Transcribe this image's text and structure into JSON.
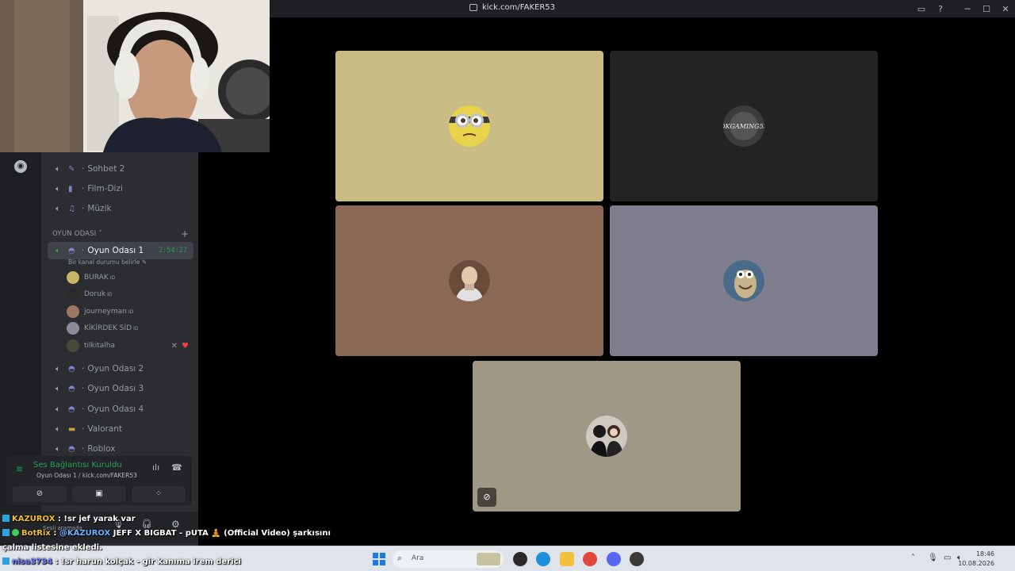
{
  "window": {
    "url_title": "kick.com/FAKER53"
  },
  "sidebar": {
    "channels_top": [
      {
        "label": "Sohbet 2",
        "icon": "chat-icon"
      },
      {
        "label": "Film-Dizi",
        "icon": "film-icon"
      },
      {
        "label": "Müzik",
        "icon": "music-icon"
      }
    ],
    "category": "OYUN ODASI",
    "active_channel": {
      "label": "Oyun Odası 1",
      "timer": "2:54:27",
      "status_placeholder": "Bir kanal durumu belirle"
    },
    "users": [
      {
        "name": "BURAK",
        "tag": "ID"
      },
      {
        "name": "Doruk",
        "tag": "ID"
      },
      {
        "name": "journeyman",
        "tag": "ID"
      },
      {
        "name": "KİKİRDEK SİD",
        "tag": "ID"
      },
      {
        "name": "tilkitalha",
        "tag": ""
      }
    ],
    "channels_bottom": [
      {
        "label": "Oyun Odası 2"
      },
      {
        "label": "Oyun Odası 3"
      },
      {
        "label": "Oyun Odası 4"
      },
      {
        "label": "Valorant"
      },
      {
        "label": "Roblox"
      }
    ]
  },
  "voice_panel": {
    "status": "Ses Bağlantısı Kuruldu",
    "sub": "Oyun Odası 1 / kick.com/FAKER53"
  },
  "user_bar": {
    "status": "Sesli aramada"
  },
  "tiles": [
    {
      "color": "#c9bb84",
      "avatar": "minion-avatar"
    },
    {
      "color": "#242424",
      "avatar": "dkgaming-avatar",
      "avatar_text": "DKGAMING53"
    },
    {
      "color": "#8c6957",
      "avatar": "oldman-avatar"
    },
    {
      "color": "#7f7e8f",
      "avatar": "sid-avatar"
    },
    {
      "color": "#9e9887",
      "avatar": "couple-avatar"
    }
  ],
  "chat": [
    {
      "user": "KAZUROX",
      "sep": " : ",
      "msg": "!sr jef yarak var"
    },
    {
      "user": "BotRix",
      "sep": " : ",
      "mention": "@KAZUROX",
      "msg": " JEFF X BIGBAT - pUTA 🧘 (Official Video) şarkısını"
    },
    {
      "msg": "çalma listesine ekledi."
    },
    {
      "user": "nisa3734",
      "sep": " : ",
      "msg": "!sr harun kolçak - gir kanıma irem derici"
    }
  ],
  "taskbar": {
    "search_placeholder": "Ara",
    "time": "18:46",
    "date": "10.08.2026"
  }
}
